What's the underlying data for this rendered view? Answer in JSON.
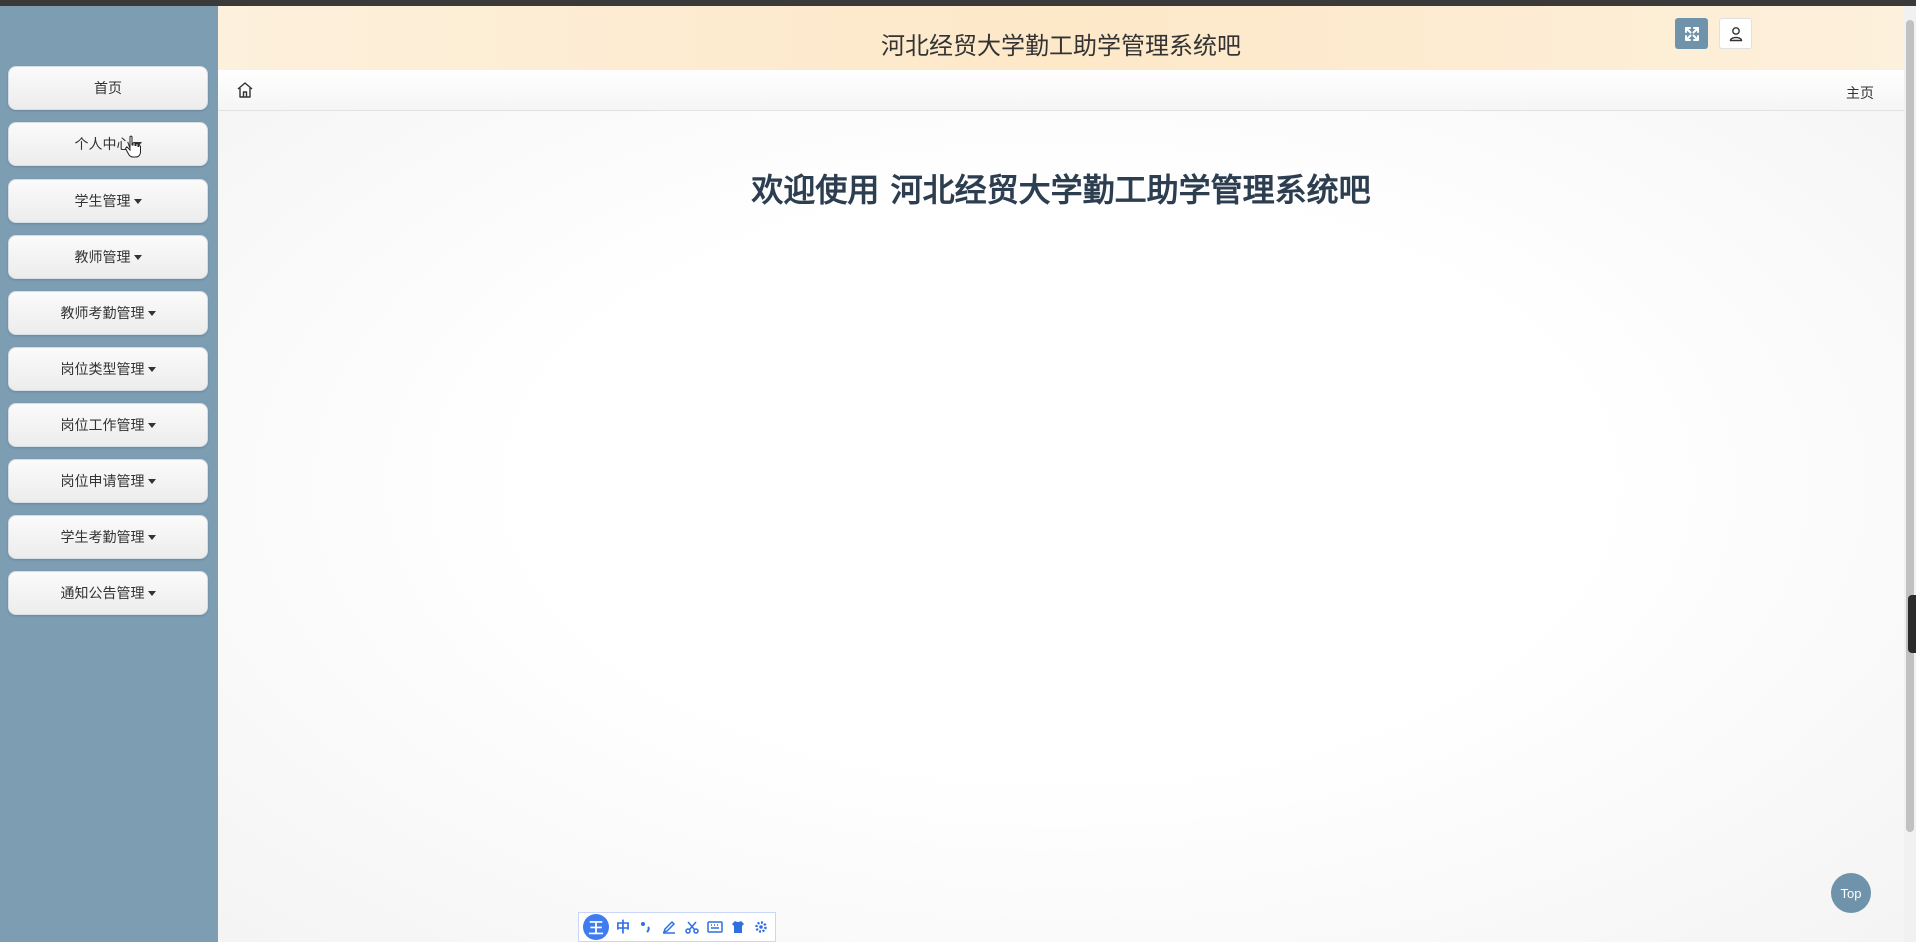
{
  "header": {
    "title": "河北经贸大学勤工助学管理系统吧"
  },
  "breadcrumb": {
    "current": "主页"
  },
  "main": {
    "welcome": "欢迎使用 河北经贸大学勤工助学管理系统吧"
  },
  "sidebar": {
    "items": [
      {
        "label": "首页",
        "has_caret": false
      },
      {
        "label": "个人中心",
        "has_caret": true
      },
      {
        "label": "学生管理",
        "has_caret": true
      },
      {
        "label": "教师管理",
        "has_caret": true
      },
      {
        "label": "教师考勤管理",
        "has_caret": true
      },
      {
        "label": "岗位类型管理",
        "has_caret": true
      },
      {
        "label": "岗位工作管理",
        "has_caret": true
      },
      {
        "label": "岗位申请管理",
        "has_caret": true
      },
      {
        "label": "学生考勤管理",
        "has_caret": true
      },
      {
        "label": "通知公告管理",
        "has_caret": true
      }
    ]
  },
  "back_to_top": {
    "label": "Top"
  },
  "ime_toolbar": {
    "logo": "王",
    "mode": "中",
    "icons": [
      "punctuation-icon",
      "pen-icon",
      "scissors-icon",
      "keyboard-icon",
      "skin-icon",
      "settings-icon"
    ]
  },
  "colors": {
    "sidebar_bg": "#7d9db3",
    "accent": "#6e93ab",
    "header_bg": "#fde8c8",
    "welcome_text": "#2c3e50"
  }
}
